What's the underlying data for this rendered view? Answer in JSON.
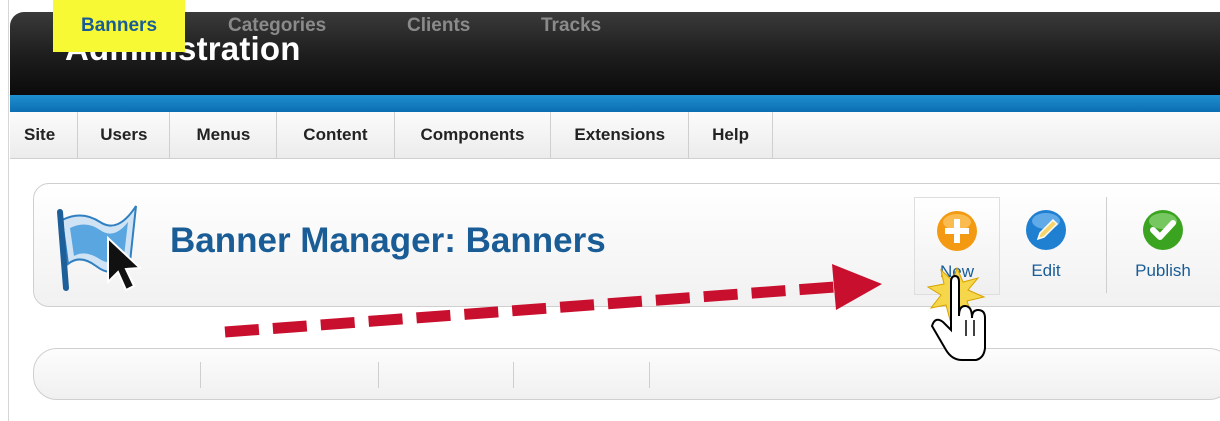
{
  "header": {
    "title": "Administration"
  },
  "menu": {
    "items": [
      "Site",
      "Users",
      "Menus",
      "Content",
      "Components",
      "Extensions",
      "Help"
    ]
  },
  "toolbar": {
    "page_title": "Banner Manager: Banners",
    "buttons": {
      "new": "New",
      "edit": "Edit",
      "publish": "Publish"
    }
  },
  "subtabs": {
    "items": [
      "Banners",
      "Categories",
      "Clients",
      "Tracks"
    ],
    "active": "Banners"
  },
  "colors": {
    "header_dark": "#1c1c1c",
    "stripe_blue": "#0b6eb2",
    "title_blue": "#1a5d96",
    "highlight_yellow": "#f6f934",
    "arrow_red": "#c8102e",
    "new_orange": "#f39a12",
    "edit_blue": "#1f7fd1",
    "publish_green": "#3aa320"
  },
  "icons": [
    "banner-flag-icon",
    "new-plus-icon",
    "edit-pencil-icon",
    "publish-check-icon",
    "hand-cursor-icon",
    "click-burst-icon"
  ]
}
